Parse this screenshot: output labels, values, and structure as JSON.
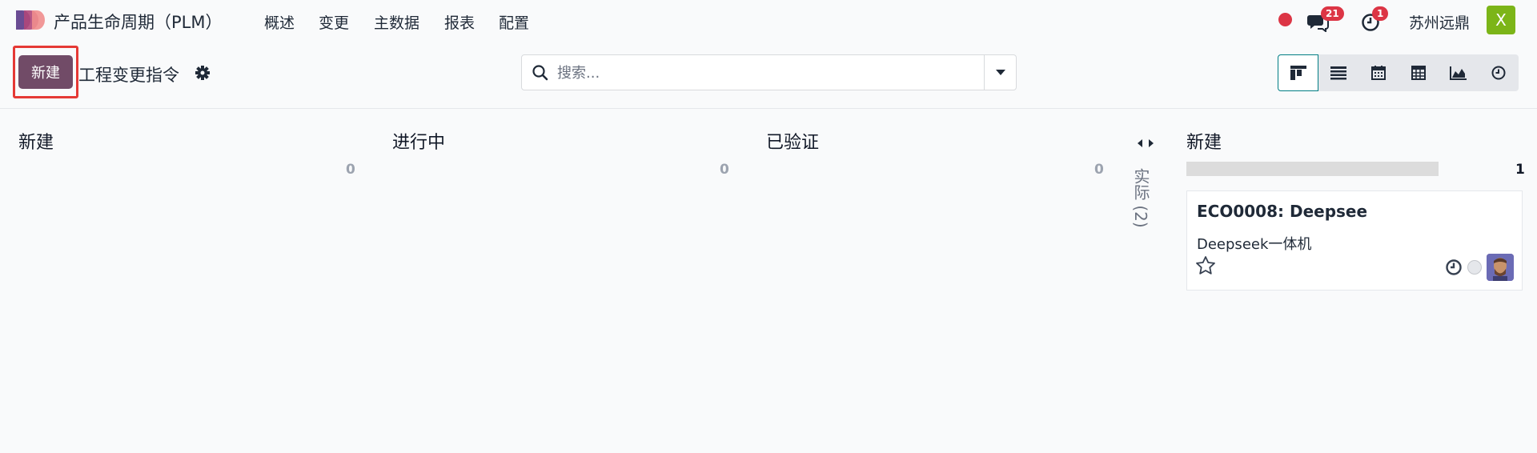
{
  "navbar": {
    "app_title": "产品生命周期（PLM）",
    "menu": [
      "概述",
      "变更",
      "主数据",
      "报表",
      "配置"
    ],
    "chat_count": "21",
    "activity_count": "1",
    "company": "苏州远鼎",
    "user_initial": "X"
  },
  "control_panel": {
    "new_button": "新建",
    "title": "工程变更指令",
    "search_placeholder": "搜索..."
  },
  "views": [
    "kanban-icon",
    "list-icon",
    "calendar-icon",
    "pivot-icon",
    "graph-icon",
    "activity-icon"
  ],
  "kanban": {
    "columns": [
      {
        "title": "新建",
        "count": "0"
      },
      {
        "title": "进行中",
        "count": "0"
      },
      {
        "title": "已验证",
        "count": "0"
      }
    ],
    "folded": {
      "label": "实际 (2)"
    },
    "last_column": {
      "title": "新建",
      "count": "1",
      "card": {
        "title": "ECO0008: Deepsee",
        "subtitle": "Deepseek一体机"
      }
    }
  },
  "colors": {
    "primary": "#714b67",
    "accent": "#017e84",
    "badge": "#dc3545",
    "avatar": "#7cb518"
  }
}
